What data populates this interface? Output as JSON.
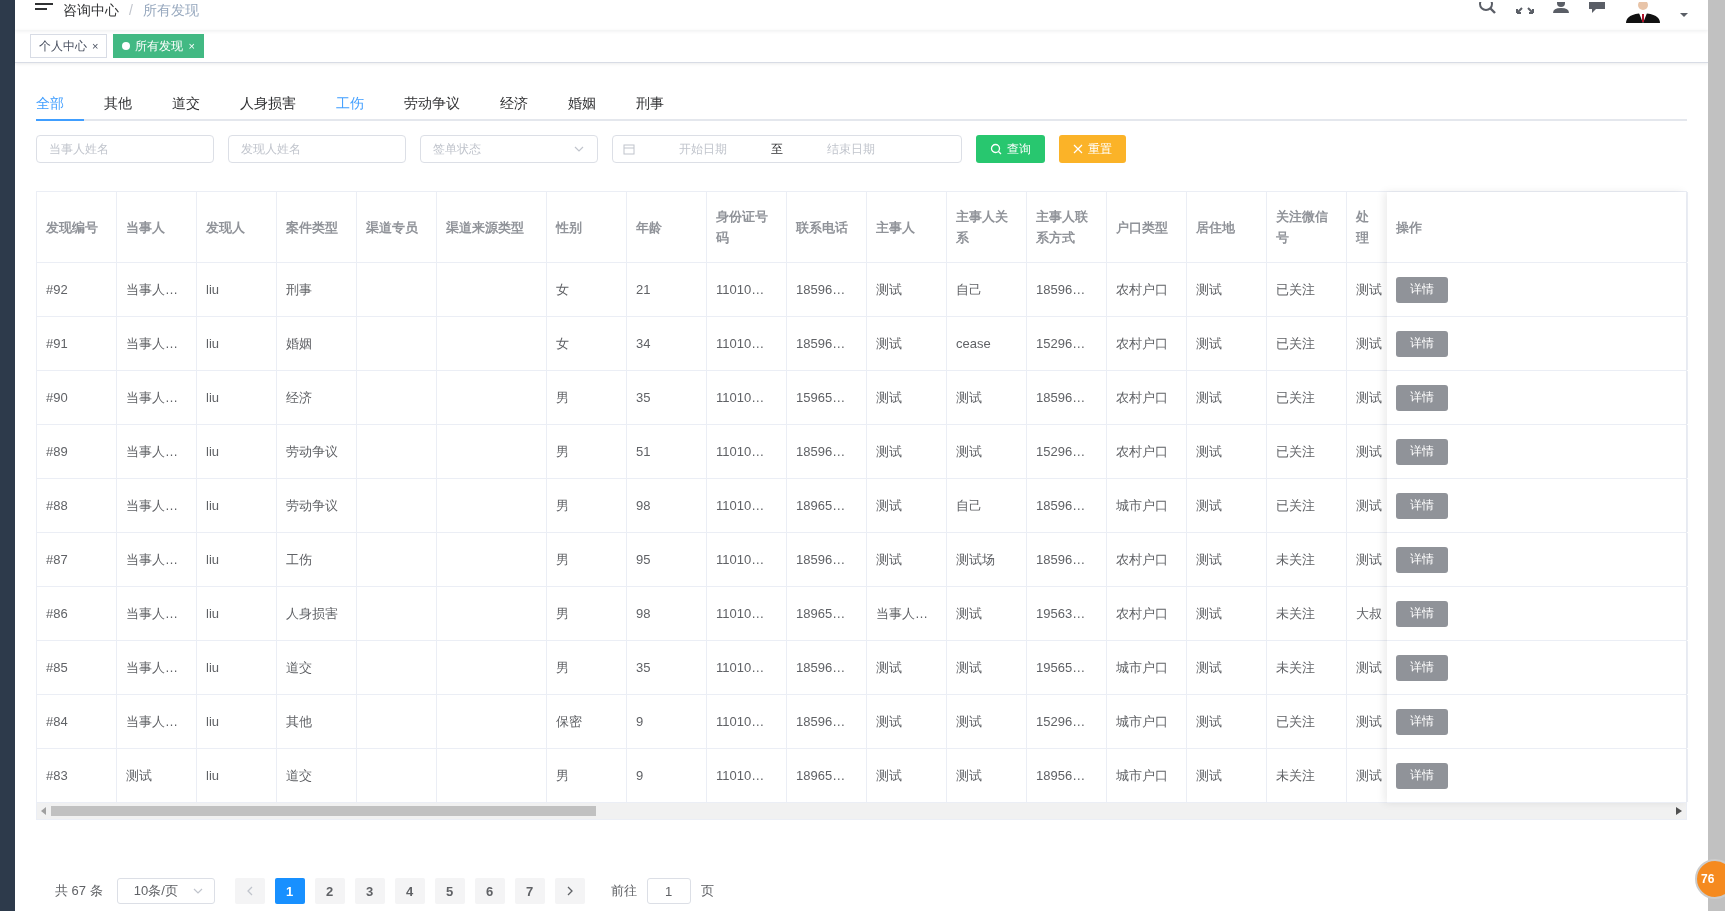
{
  "header": {
    "breadcrumb": [
      "咨询中心",
      "所有发现"
    ],
    "separator": "/"
  },
  "tags": [
    {
      "label": "个人中心",
      "selected": false,
      "close": "×"
    },
    {
      "label": "所有发现",
      "selected": true,
      "close": "×"
    }
  ],
  "category_tabs": [
    {
      "label": "全部",
      "selected": true,
      "hovered": false
    },
    {
      "label": "其他",
      "selected": false,
      "hovered": false
    },
    {
      "label": "道交",
      "selected": false,
      "hovered": false
    },
    {
      "label": "人身损害",
      "selected": false,
      "hovered": false
    },
    {
      "label": "工伤",
      "selected": false,
      "hovered": true
    },
    {
      "label": "劳动争议",
      "selected": false,
      "hovered": false
    },
    {
      "label": "经济",
      "selected": false,
      "hovered": false
    },
    {
      "label": "婚姻",
      "selected": false,
      "hovered": false
    },
    {
      "label": "刑事",
      "selected": false,
      "hovered": false
    }
  ],
  "filters": {
    "party_name": {
      "placeholder": "当事人姓名"
    },
    "finder_name": {
      "placeholder": "发现人姓名"
    },
    "sign_status": {
      "placeholder": "签单状态"
    },
    "date_range": {
      "start_placeholder": "开始日期",
      "separator": "至",
      "end_placeholder": "结束日期"
    }
  },
  "buttons": {
    "query": "查询",
    "reset": "重置"
  },
  "table": {
    "columns": [
      "发现编号",
      "当事人",
      "发现人",
      "案件类型",
      "渠道专员",
      "渠道来源类型",
      "性别",
      "年龄",
      "身份证号码",
      "联系电话",
      "主事人",
      "主事人关系",
      "主事人联系方式",
      "户口类型",
      "居住地",
      "关注微信号",
      "处理"
    ],
    "action_column": "操作",
    "rows": [
      {
        "cells": [
          "#92",
          "当事人…",
          "liu",
          "刑事",
          "",
          "",
          "女",
          "21",
          "11010…",
          "18596…",
          "测试",
          "自己",
          "18596…",
          "农村户口",
          "测试",
          "已关注",
          "测试"
        ],
        "action": "详情"
      },
      {
        "cells": [
          "#91",
          "当事人…",
          "liu",
          "婚姻",
          "",
          "",
          "女",
          "34",
          "11010…",
          "18596…",
          "测试",
          "cease",
          "15296…",
          "农村户口",
          "测试",
          "已关注",
          "测试"
        ],
        "action": "详情"
      },
      {
        "cells": [
          "#90",
          "当事人…",
          "liu",
          "经济",
          "",
          "",
          "男",
          "35",
          "11010…",
          "15965…",
          "测试",
          "测试",
          "18596…",
          "农村户口",
          "测试",
          "已关注",
          "测试"
        ],
        "action": "详情"
      },
      {
        "cells": [
          "#89",
          "当事人…",
          "liu",
          "劳动争议",
          "",
          "",
          "男",
          "51",
          "11010…",
          "18596…",
          "测试",
          "测试",
          "15296…",
          "农村户口",
          "测试",
          "已关注",
          "测试"
        ],
        "action": "详情"
      },
      {
        "cells": [
          "#88",
          "当事人…",
          "liu",
          "劳动争议",
          "",
          "",
          "男",
          "98",
          "11010…",
          "18965…",
          "测试",
          "自己",
          "18596…",
          "城市户口",
          "测试",
          "已关注",
          "测试"
        ],
        "action": "详情"
      },
      {
        "cells": [
          "#87",
          "当事人…",
          "liu",
          "工伤",
          "",
          "",
          "男",
          "95",
          "11010…",
          "18596…",
          "测试",
          "测试场",
          "18596…",
          "农村户口",
          "测试",
          "未关注",
          "测试"
        ],
        "action": "详情"
      },
      {
        "cells": [
          "#86",
          "当事人…",
          "liu",
          "人身损害",
          "",
          "",
          "男",
          "98",
          "11010…",
          "18965…",
          "当事人…",
          "测试",
          "19563…",
          "农村户口",
          "测试",
          "未关注",
          "大叔"
        ],
        "action": "详情"
      },
      {
        "cells": [
          "#85",
          "当事人…",
          "liu",
          "道交",
          "",
          "",
          "男",
          "35",
          "11010…",
          "18596…",
          "测试",
          "测试",
          "19565…",
          "城市户口",
          "测试",
          "未关注",
          "测试"
        ],
        "action": "详情"
      },
      {
        "cells": [
          "#84",
          "当事人…",
          "liu",
          "其他",
          "",
          "",
          "保密",
          "9",
          "11010…",
          "18596…",
          "测试",
          "测试",
          "15296…",
          "城市户口",
          "测试",
          "已关注",
          "测试"
        ],
        "action": "详情"
      },
      {
        "cells": [
          "#83",
          "测试",
          "liu",
          "道交",
          "",
          "",
          "男",
          "9",
          "11010…",
          "18965…",
          "测试",
          "测试",
          "18956…",
          "城市户口",
          "测试",
          "未关注",
          "测试"
        ],
        "action": "详情"
      }
    ]
  },
  "pagination": {
    "total": "共 67 条",
    "page_size": "10条/页",
    "pages": [
      {
        "label": "1",
        "selected": true
      },
      {
        "label": "2",
        "selected": false
      },
      {
        "label": "3",
        "selected": false
      },
      {
        "label": "4",
        "selected": false
      },
      {
        "label": "5",
        "selected": false
      },
      {
        "label": "6",
        "selected": false
      },
      {
        "label": "7",
        "selected": false
      }
    ],
    "goto_label": "前往",
    "goto_value": "1",
    "page_suffix": "页"
  },
  "badge": "76"
}
